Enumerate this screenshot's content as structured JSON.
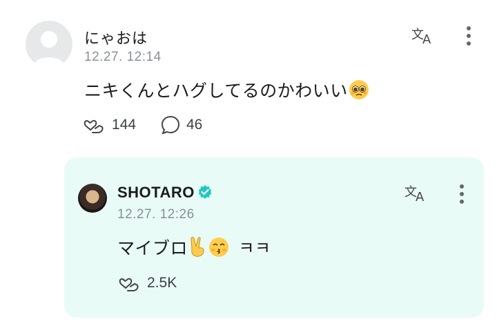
{
  "comment": {
    "username": "にゃおは",
    "timestamp": "12.27. 12:14",
    "text": "ニキくんとハグしてるのかわいい",
    "text_emoji": "pleading-face-emoji",
    "likes": "144",
    "replies": "46"
  },
  "reply": {
    "username": "SHOTARO",
    "verified": true,
    "timestamp": "12.27. 12:26",
    "text": "マイブロ",
    "text_suffix": "ㅋㅋ",
    "text_emojis": [
      "victory-hand-emoji",
      "kissing-face-emoji"
    ],
    "likes": "2.5K"
  },
  "colors": {
    "reply_background": "#e8fbf7",
    "verified_badge": "#22c8c0",
    "timestamp": "#8a8f96"
  },
  "icons": {
    "translate": "translate-icon",
    "more": "more-vertical-icon",
    "like": "heart-hand-icon",
    "comment": "speech-bubble-icon"
  }
}
